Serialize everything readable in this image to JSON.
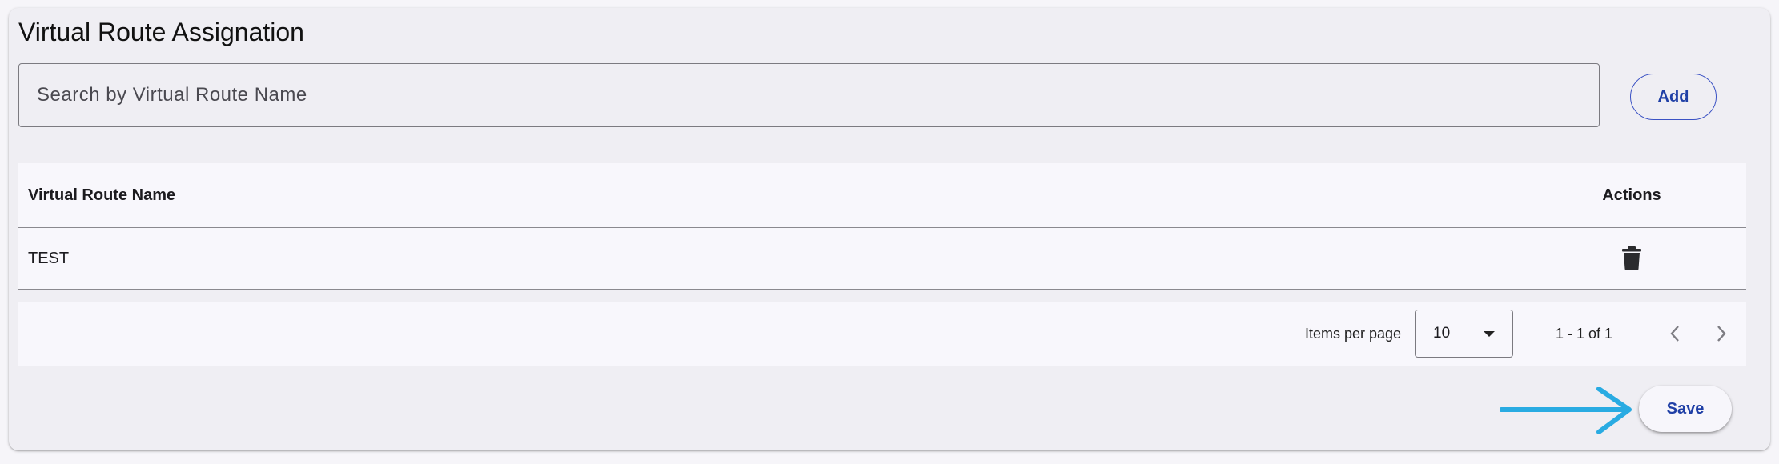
{
  "panel": {
    "title": "Virtual Route Assignation"
  },
  "search": {
    "placeholder": "Search by Virtual Route Name"
  },
  "actions": {
    "add_label": "Add",
    "save_label": "Save"
  },
  "table": {
    "columns": [
      "Virtual Route Name",
      "Actions"
    ],
    "rows": [
      {
        "name": "TEST",
        "action_icon": "delete-icon"
      }
    ]
  },
  "paginator": {
    "items_per_page_label": "Items per page",
    "items_per_page_value": "10",
    "range_label": "1 - 1 of 1"
  },
  "annotation": {
    "arrow_color": "#29abe2"
  },
  "colors": {
    "accent": "#1f3fa6"
  }
}
